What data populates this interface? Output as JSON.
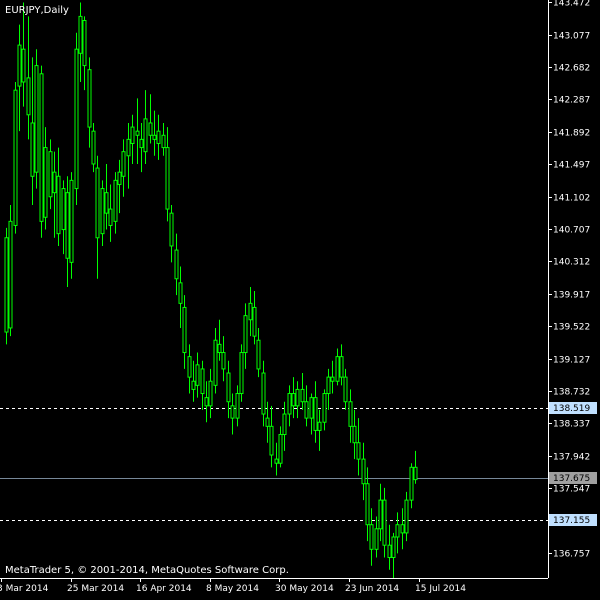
{
  "header": {
    "symbol_timeframe": "EURJPY,Daily"
  },
  "footer": {
    "credit": "MetaTrader 5, © 2001-2014, MetaQuotes Software Corp."
  },
  "colors": {
    "background": "#000000",
    "candle": "#00ff00",
    "axis": "#ffffff",
    "level_line": "#ffffff",
    "current_line": "#778899",
    "level_badge": "#c0e0ff",
    "current_badge": "#a0a0a0"
  },
  "chart_data": {
    "type": "candlestick",
    "title": "EURJPY,Daily",
    "ylim": [
      136.45,
      143.5
    ],
    "yticks": [
      143.472,
      143.077,
      142.682,
      142.287,
      141.892,
      141.497,
      141.102,
      140.707,
      140.312,
      139.917,
      139.522,
      139.127,
      138.732,
      138.337,
      137.942,
      137.547,
      136.757
    ],
    "ytick_labels": [
      "143.472",
      "143.077",
      "142.682",
      "142.287",
      "141.892",
      "141.497",
      "141.102",
      "140.707",
      "140.312",
      "139.917",
      "139.522",
      "139.127",
      "138.732",
      "138.337",
      "137.942",
      "137.547",
      "136.757"
    ],
    "xtick_labels": [
      "3 Mar 2014",
      "25 Mar 2014",
      "16 Apr 2014",
      "8 May 2014",
      "30 May 2014",
      "23 Jun 2014",
      "15 Jul 2014"
    ],
    "xtick_positions": [
      0,
      16,
      32,
      48,
      64,
      80,
      96
    ],
    "levels": [
      {
        "value": 138.519,
        "label": "138.519",
        "style": "dashed"
      },
      {
        "value": 137.155,
        "label": "137.155",
        "style": "dashed"
      }
    ],
    "current": {
      "value": 137.675,
      "label": "137.675"
    },
    "series": [
      {
        "name": "",
        "ohlc": [
          [
            140.6,
            140.72,
            139.3,
            139.45
          ],
          [
            139.5,
            141.0,
            139.4,
            140.8
          ],
          [
            140.75,
            142.5,
            140.65,
            142.4
          ],
          [
            142.45,
            143.2,
            141.9,
            142.95
          ],
          [
            142.9,
            143.47,
            142.2,
            142.5
          ],
          [
            142.55,
            143.3,
            141.8,
            142.1
          ],
          [
            142.0,
            142.8,
            141.0,
            141.35
          ],
          [
            141.4,
            142.9,
            141.2,
            142.7
          ],
          [
            142.6,
            142.7,
            140.6,
            140.8
          ],
          [
            140.85,
            141.95,
            140.7,
            141.7
          ],
          [
            141.65,
            141.8,
            140.95,
            141.1
          ],
          [
            141.15,
            141.65,
            140.6,
            141.4
          ],
          [
            141.35,
            141.7,
            140.5,
            140.65
          ],
          [
            140.7,
            141.3,
            140.4,
            141.2
          ],
          [
            141.15,
            141.35,
            140.0,
            140.35
          ],
          [
            140.3,
            141.4,
            140.1,
            141.3
          ],
          [
            141.2,
            143.1,
            141.0,
            142.9
          ],
          [
            142.85,
            143.47,
            142.5,
            143.3
          ],
          [
            143.25,
            143.3,
            142.4,
            142.7
          ],
          [
            142.65,
            142.8,
            141.7,
            141.95
          ],
          [
            141.9,
            142.0,
            141.4,
            141.5
          ],
          [
            141.45,
            141.6,
            140.1,
            140.6
          ],
          [
            140.65,
            141.3,
            140.5,
            141.2
          ],
          [
            141.15,
            141.5,
            140.7,
            140.9
          ],
          [
            140.95,
            141.25,
            140.55,
            140.75
          ],
          [
            140.8,
            141.4,
            140.65,
            141.3
          ],
          [
            141.25,
            141.55,
            140.9,
            141.4
          ],
          [
            141.35,
            141.8,
            141.1,
            141.65
          ],
          [
            141.6,
            142.0,
            141.2,
            141.8
          ],
          [
            141.75,
            142.1,
            141.5,
            141.95
          ],
          [
            141.9,
            142.3,
            141.5,
            141.85
          ],
          [
            141.8,
            142.0,
            141.4,
            141.7
          ],
          [
            141.65,
            142.4,
            141.5,
            142.05
          ],
          [
            142.0,
            142.35,
            141.75,
            141.85
          ],
          [
            141.85,
            142.15,
            141.6,
            141.8
          ],
          [
            141.75,
            142.1,
            141.55,
            141.9
          ],
          [
            141.85,
            142.0,
            141.6,
            141.7
          ],
          [
            141.7,
            141.95,
            140.8,
            140.95
          ],
          [
            140.9,
            141.0,
            140.3,
            140.5
          ],
          [
            140.45,
            140.65,
            139.9,
            140.1
          ],
          [
            140.05,
            140.25,
            139.5,
            139.8
          ],
          [
            139.75,
            139.9,
            139.0,
            139.2
          ],
          [
            139.15,
            139.3,
            138.7,
            138.9
          ],
          [
            138.85,
            139.1,
            138.6,
            138.75
          ],
          [
            138.8,
            139.2,
            138.65,
            139.05
          ],
          [
            139.0,
            139.1,
            138.5,
            138.7
          ],
          [
            138.65,
            138.85,
            138.35,
            138.55
          ],
          [
            138.55,
            139.0,
            138.4,
            138.85
          ],
          [
            138.8,
            139.5,
            138.7,
            139.35
          ],
          [
            139.3,
            139.6,
            139.1,
            139.2
          ],
          [
            139.2,
            139.4,
            138.85,
            139.0
          ],
          [
            138.95,
            139.1,
            138.4,
            138.6
          ],
          [
            138.55,
            138.7,
            138.2,
            138.4
          ],
          [
            138.4,
            138.8,
            138.3,
            138.7
          ],
          [
            138.7,
            139.3,
            138.6,
            139.2
          ],
          [
            139.2,
            139.8,
            139.0,
            139.65
          ],
          [
            139.6,
            140.0,
            139.4,
            139.8
          ],
          [
            139.75,
            139.95,
            139.3,
            139.4
          ],
          [
            139.35,
            139.5,
            138.9,
            139.0
          ],
          [
            138.95,
            139.1,
            138.3,
            138.45
          ],
          [
            138.4,
            138.6,
            138.1,
            138.3
          ],
          [
            138.3,
            138.55,
            137.8,
            137.95
          ],
          [
            137.9,
            138.1,
            137.7,
            137.85
          ],
          [
            137.85,
            138.3,
            137.8,
            138.2
          ],
          [
            138.2,
            138.6,
            138.0,
            138.45
          ],
          [
            138.45,
            138.8,
            138.3,
            138.7
          ],
          [
            138.7,
            138.9,
            138.4,
            138.55
          ],
          [
            138.55,
            138.85,
            138.4,
            138.75
          ],
          [
            138.75,
            138.95,
            138.5,
            138.6
          ],
          [
            138.6,
            138.8,
            138.3,
            138.4
          ],
          [
            138.4,
            138.7,
            138.2,
            138.65
          ],
          [
            138.65,
            138.85,
            138.1,
            138.25
          ],
          [
            138.25,
            138.5,
            138.0,
            138.35
          ],
          [
            138.35,
            138.75,
            138.25,
            138.7
          ],
          [
            138.7,
            139.0,
            138.5,
            138.9
          ],
          [
            138.9,
            139.1,
            138.7,
            138.85
          ],
          [
            138.85,
            139.25,
            138.8,
            139.15
          ],
          [
            139.15,
            139.3,
            138.8,
            138.9
          ],
          [
            138.9,
            139.0,
            138.5,
            138.6
          ],
          [
            138.6,
            138.75,
            138.1,
            138.3
          ],
          [
            138.3,
            138.5,
            137.9,
            138.1
          ],
          [
            138.1,
            138.4,
            137.7,
            137.9
          ],
          [
            137.9,
            138.1,
            137.4,
            137.6
          ],
          [
            137.6,
            137.8,
            136.9,
            137.1
          ],
          [
            137.1,
            137.3,
            136.6,
            136.8
          ],
          [
            136.8,
            137.2,
            136.7,
            137.05
          ],
          [
            137.05,
            137.6,
            136.9,
            137.4
          ],
          [
            137.4,
            137.55,
            136.7,
            136.85
          ],
          [
            136.85,
            137.1,
            136.55,
            136.7
          ],
          [
            136.7,
            137.0,
            136.45,
            136.95
          ],
          [
            136.95,
            137.25,
            136.75,
            137.1
          ],
          [
            137.1,
            137.3,
            136.8,
            137.0
          ],
          [
            137.0,
            137.5,
            136.9,
            137.4
          ],
          [
            137.4,
            137.85,
            137.3,
            137.8
          ],
          [
            137.8,
            138.0,
            137.6,
            137.65
          ]
        ]
      }
    ]
  }
}
